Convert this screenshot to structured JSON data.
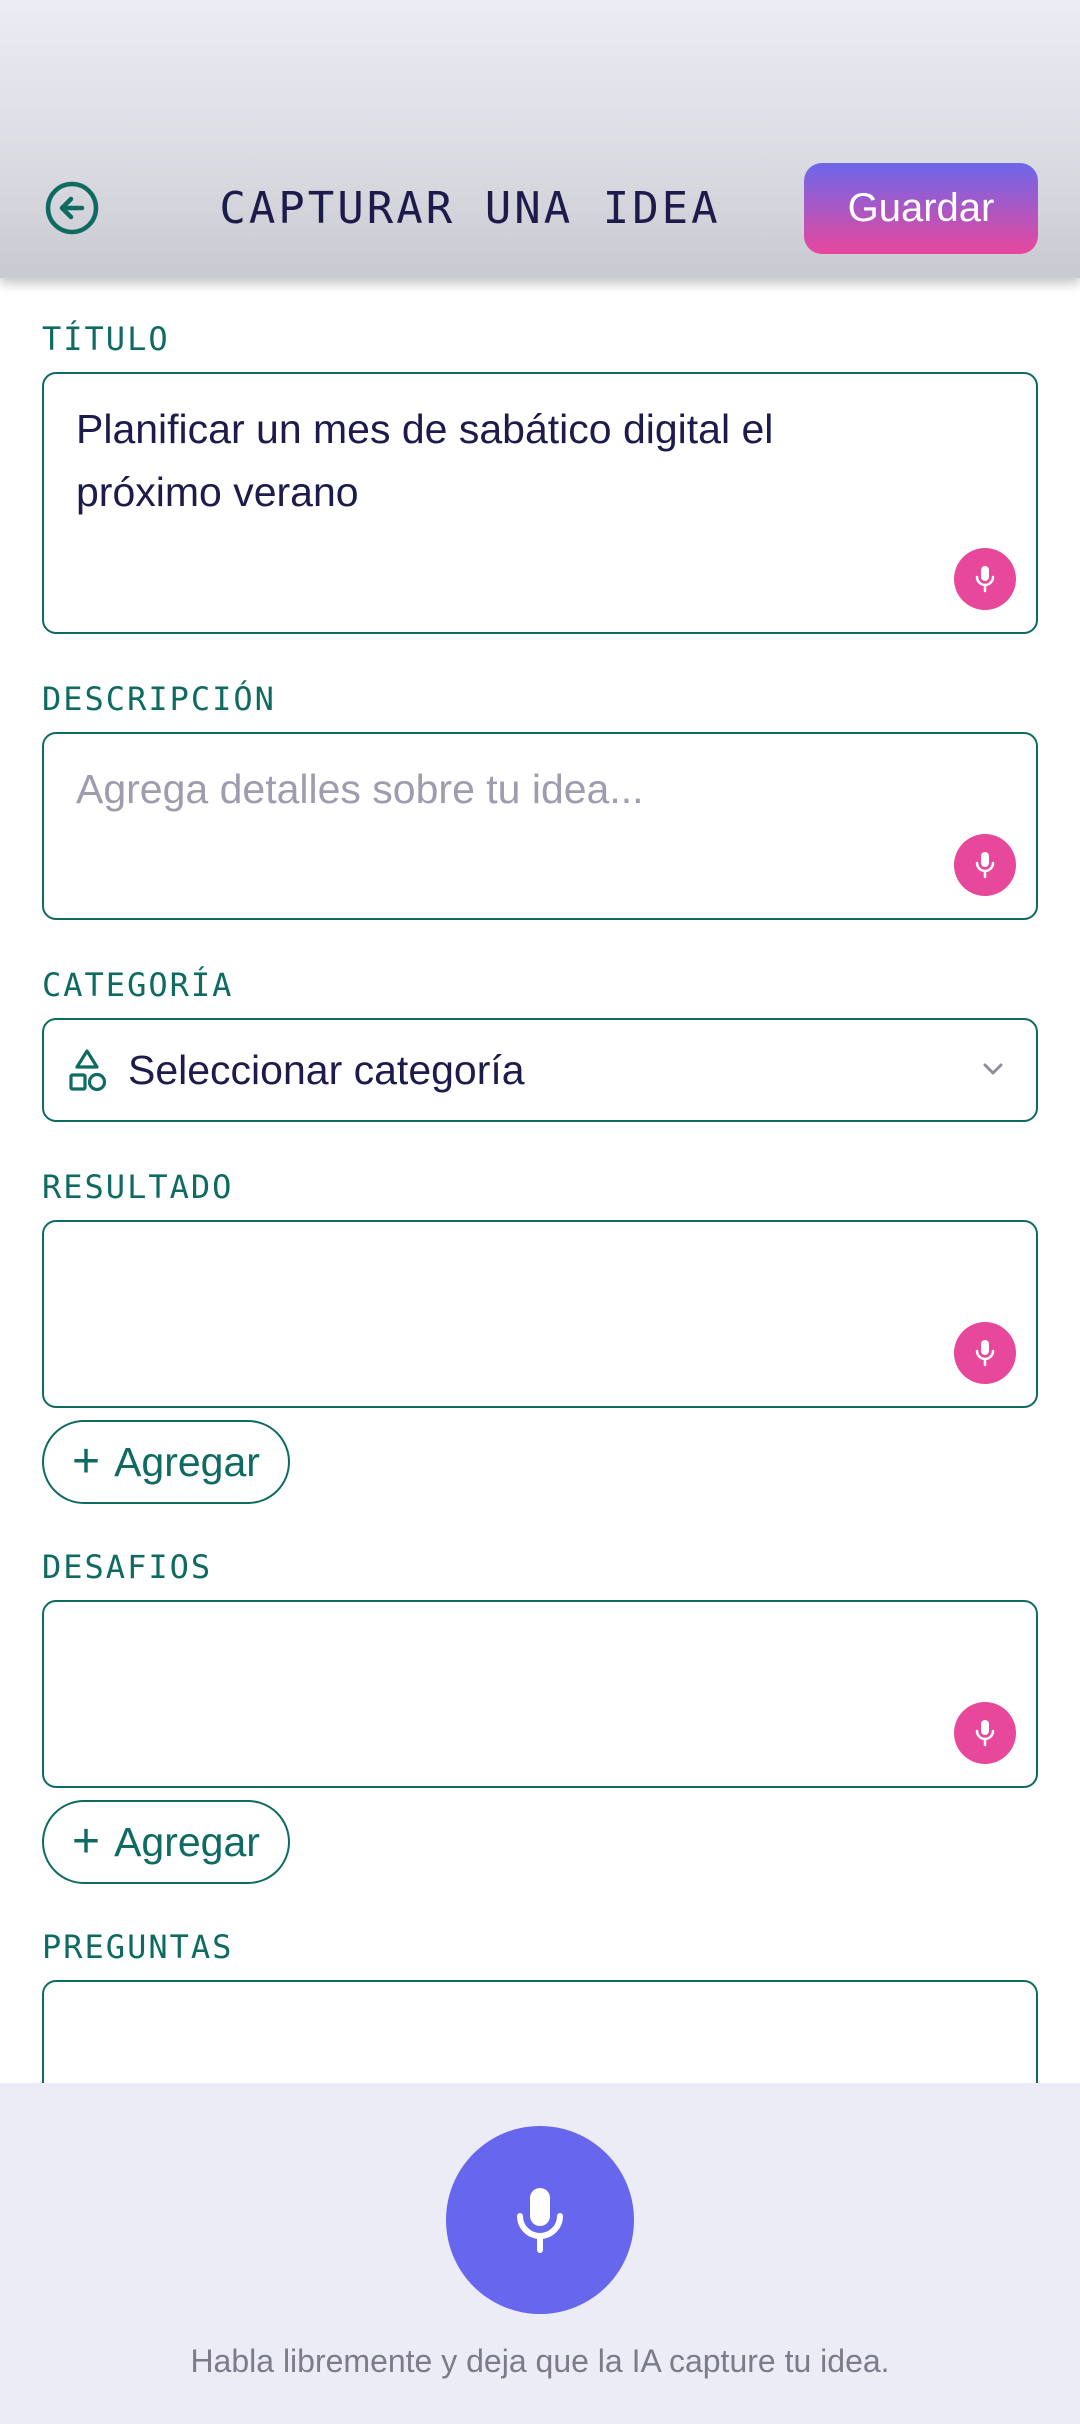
{
  "header": {
    "title": "CAPTURAR UNA IDEA",
    "save_label": "Guardar",
    "back_icon": "arrow-left-circle-icon"
  },
  "form": {
    "title_field": {
      "label": "TÍTULO",
      "value": "Planificar un mes de sabático digital el próximo verano"
    },
    "description_field": {
      "label": "DESCRIPCIÓN",
      "value": "",
      "placeholder": "Agrega detalles sobre tu idea..."
    },
    "category_field": {
      "label": "CATEGORÍA",
      "selected": "Seleccionar categoría",
      "icon": "shapes-icon"
    },
    "result_field": {
      "label": "RESULTADO",
      "value": "",
      "add_label": "Agregar"
    },
    "challenges_field": {
      "label": "DESAFIOS",
      "value": "",
      "add_label": "Agregar"
    },
    "questions_field": {
      "label": "PREGUNTAS",
      "value": ""
    }
  },
  "voice": {
    "hint": "Habla libremente y deja que la IA capture tu idea."
  },
  "colors": {
    "accent_teal": "#0f6b61",
    "mic_pink": "#e8489c",
    "mic_purple": "#6767ee",
    "save_gradient_top": "#6c67ea",
    "save_gradient_bottom": "#e8489c",
    "text_dark": "#1c1b4b"
  }
}
